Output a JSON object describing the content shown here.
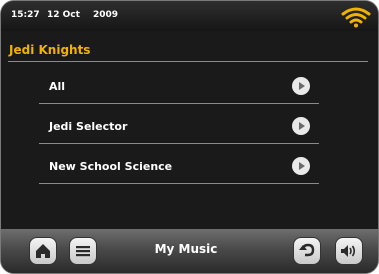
{
  "status": {
    "time": "15:27",
    "date": "12 Oct",
    "year": "2009",
    "wifi_icon": "wifi-icon"
  },
  "header": {
    "title": "Jedi Knights"
  },
  "colors": {
    "accent": "#f0b400",
    "background": "#1a1a1a",
    "text": "#ffffff"
  },
  "list": {
    "items": [
      {
        "label": "All",
        "icon": "play-icon"
      },
      {
        "label": "Jedi Selector",
        "icon": "play-icon"
      },
      {
        "label": "New School Science",
        "icon": "play-icon"
      }
    ]
  },
  "bottom_bar": {
    "title": "My Music",
    "buttons": [
      "home-icon",
      "menu-icon",
      "back-icon",
      "volume-icon"
    ]
  }
}
